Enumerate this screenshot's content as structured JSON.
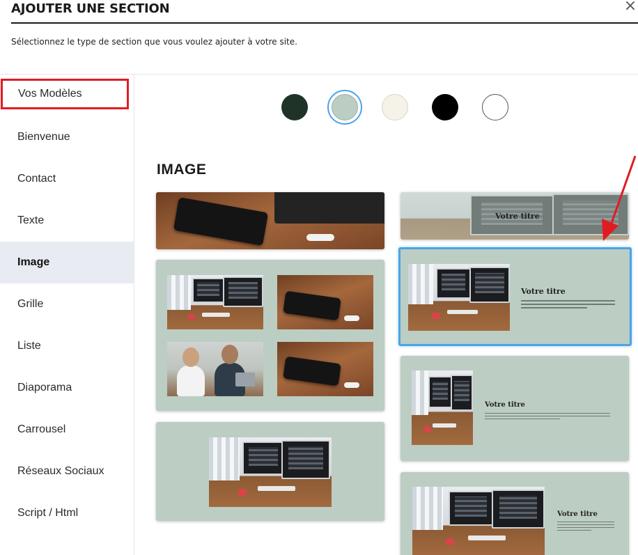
{
  "dialog": {
    "title": "AJOUTER UNE SECTION",
    "close_label": "×",
    "subtitle": "Sélectionnez le type de section que vous voulez ajouter à votre site."
  },
  "sidebar": {
    "items": [
      {
        "label": "Vos Modèles",
        "highlighted": true
      },
      {
        "label": "Bienvenue"
      },
      {
        "label": "Contact"
      },
      {
        "label": "Texte"
      },
      {
        "label": "Image",
        "active": true
      },
      {
        "label": "Grille"
      },
      {
        "label": "Liste"
      },
      {
        "label": "Diaporama"
      },
      {
        "label": "Carrousel"
      },
      {
        "label": "Réseaux Sociaux"
      },
      {
        "label": "Script / Html"
      }
    ]
  },
  "color_swatches": [
    {
      "color": "#1f3329"
    },
    {
      "color": "#bccdc3",
      "selected": true
    },
    {
      "color": "#f5f2e8"
    },
    {
      "color": "#000000"
    },
    {
      "color": "#ffffff"
    }
  ],
  "main": {
    "section_title": "IMAGE",
    "templates": [
      {
        "id": "banner-left"
      },
      {
        "id": "banner-right",
        "title": "Votre titre"
      },
      {
        "id": "grid-4"
      },
      {
        "id": "image-text-wide",
        "title": "Votre titre",
        "selected": true
      },
      {
        "id": "image-centered"
      },
      {
        "id": "image-text-narrow",
        "title": "Votre titre"
      },
      {
        "id": "image-text-bottom",
        "title": "Votre titre"
      }
    ]
  },
  "colors": {
    "accent": "#4aa3e8",
    "highlight_red": "#e21b23",
    "card_bg": "#bccdc3",
    "sidebar_active": "#e8ecf2"
  }
}
